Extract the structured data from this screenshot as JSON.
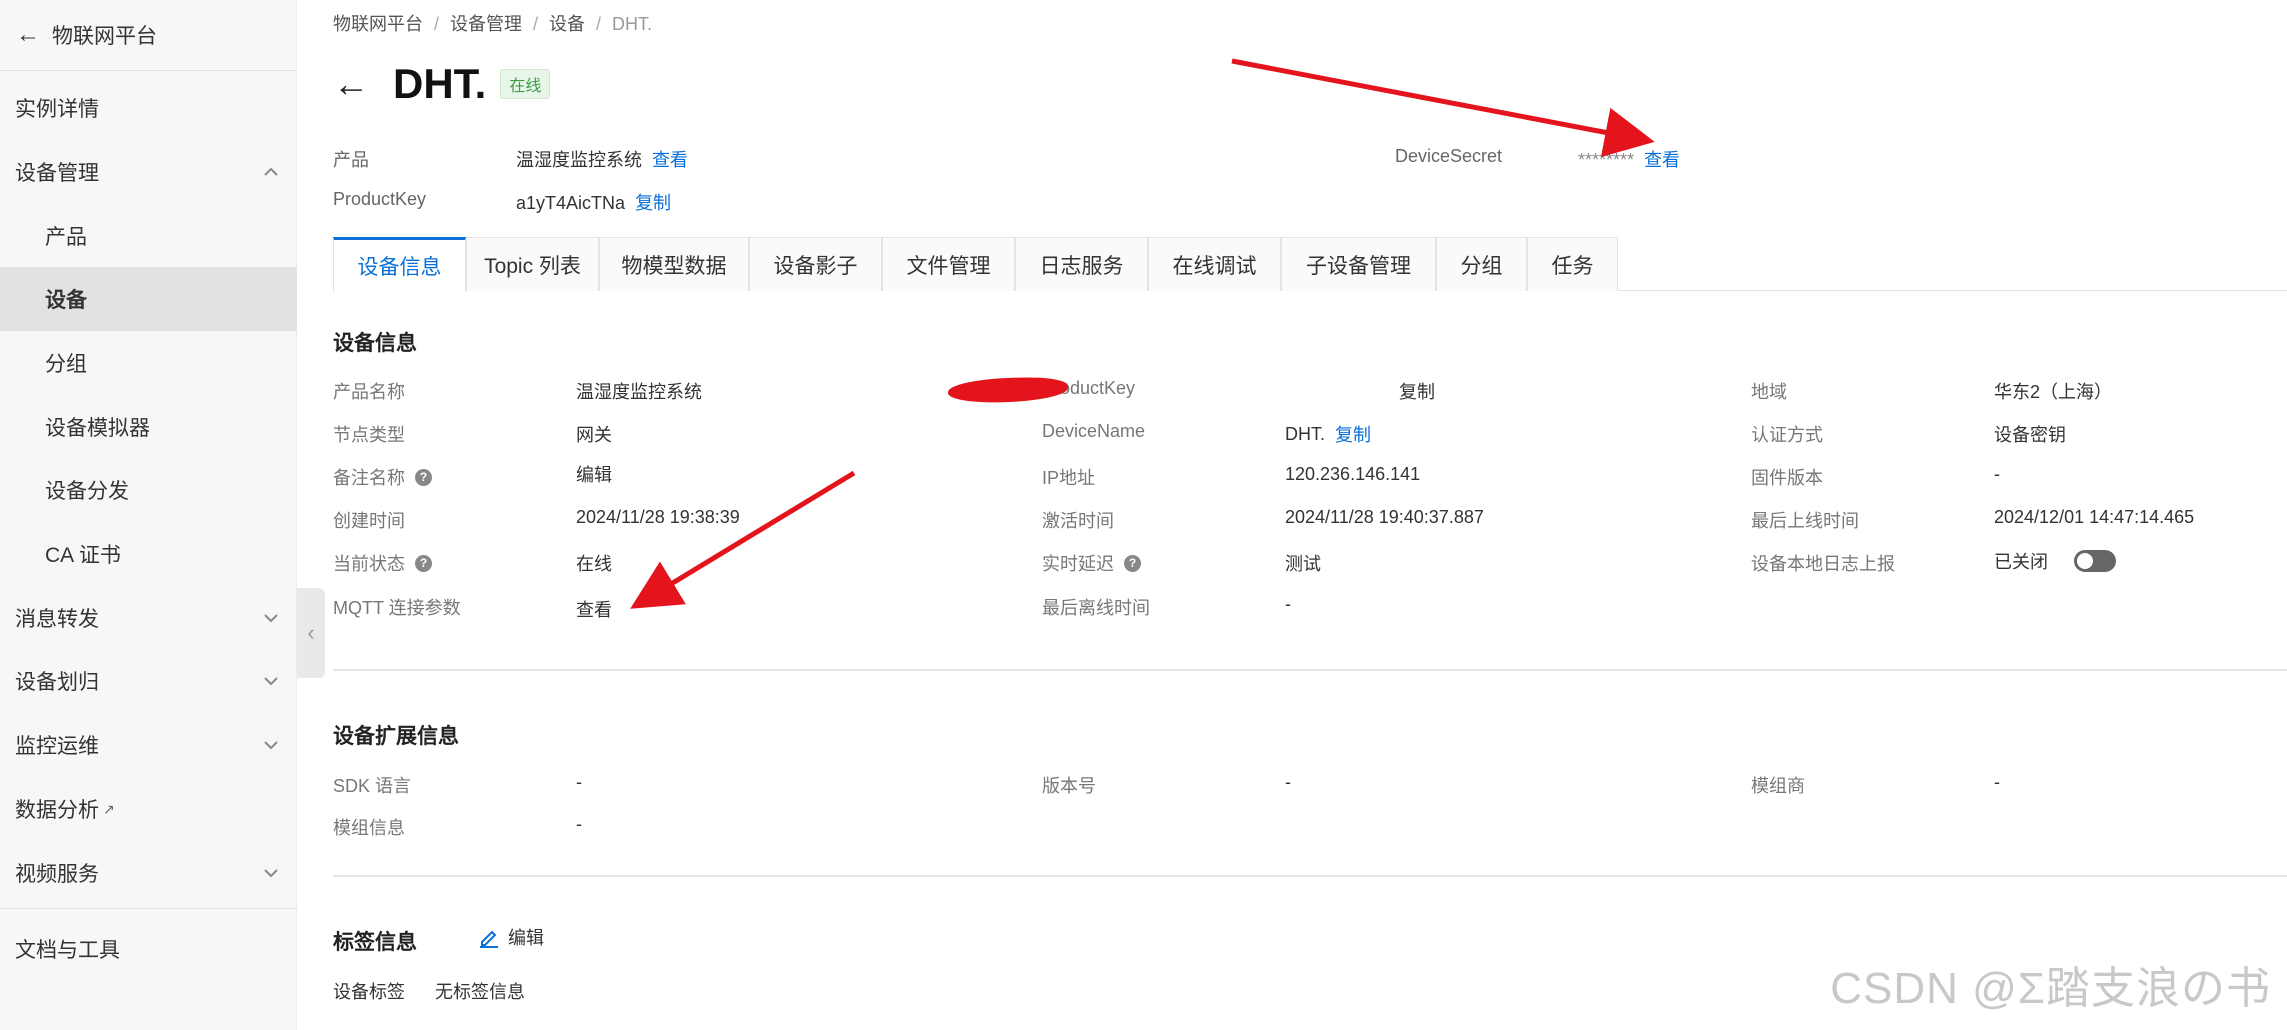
{
  "sidebar": {
    "back_title": "物联网平台",
    "items": [
      {
        "label": "实例详情"
      },
      {
        "label": "设备管理"
      },
      {
        "label": "产品"
      },
      {
        "label": "设备"
      },
      {
        "label": "分组"
      },
      {
        "label": "设备模拟器"
      },
      {
        "label": "设备分发"
      },
      {
        "label": "CA 证书"
      },
      {
        "label": "消息转发"
      },
      {
        "label": "设备划归"
      },
      {
        "label": "监控运维"
      },
      {
        "label": "数据分析"
      },
      {
        "label": "视频服务"
      },
      {
        "label": "文档与工具"
      }
    ]
  },
  "breadcrumb": [
    "物联网平台",
    "设备管理",
    "设备",
    "DHT."
  ],
  "header": {
    "title": "DHT.",
    "status_badge": "在线",
    "product_label": "产品",
    "product_value": "温湿度监控系统",
    "product_link": "查看",
    "productkey_label": "ProductKey",
    "productkey_value": "a1yT4AicTNa",
    "productkey_link": "复制",
    "devicesecret_label": "DeviceSecret",
    "devicesecret_value": "********",
    "devicesecret_link": "查看"
  },
  "tabs": [
    "设备信息",
    "Topic 列表",
    "物模型数据",
    "设备影子",
    "文件管理",
    "日志服务",
    "在线调试",
    "子设备管理",
    "分组",
    "任务"
  ],
  "device_info": {
    "title": "设备信息",
    "product_name_label": "产品名称",
    "product_name_value": "温湿度监控系统",
    "node_type_label": "节点类型",
    "node_type_value": "网关",
    "remark_label": "备注名称",
    "remark_link": "编辑",
    "created_label": "创建时间",
    "created_value": "2024/11/28 19:38:39",
    "state_label": "当前状态",
    "state_value": "在线",
    "mqtt_label": "MQTT 连接参数",
    "mqtt_link": "查看",
    "pk_label": "ProductKey",
    "pk_link": "复制",
    "devname_label": "DeviceName",
    "devname_value": "DHT.",
    "devname_link": "复制",
    "ip_label": "IP地址",
    "ip_value": "120.236.146.141",
    "activated_label": "激活时间",
    "activated_value": "2024/11/28 19:40:37.887",
    "latency_label": "实时延迟",
    "latency_link": "测试",
    "last_offline_label": "最后离线时间",
    "last_offline_value": "-",
    "region_label": "地域",
    "region_value": "华东2（上海）",
    "auth_label": "认证方式",
    "auth_value": "设备密钥",
    "firmware_label": "固件版本",
    "firmware_value": "-",
    "last_online_label": "最后上线时间",
    "last_online_value": "2024/12/01 14:47:14.465",
    "local_log_label": "设备本地日志上报",
    "local_log_value": "已关闭",
    "local_log_enabled": false
  },
  "ext_info": {
    "title": "设备扩展信息",
    "sdk_label": "SDK 语言",
    "sdk_value": "-",
    "version_label": "版本号",
    "version_value": "-",
    "vendor_label": "模组商",
    "vendor_value": "-",
    "module_label": "模组信息",
    "module_value": "-"
  },
  "tag_info": {
    "title": "标签信息",
    "edit_link": "编辑",
    "device_tag_label": "设备标签",
    "device_tag_value": "无标签信息"
  },
  "watermark": "CSDN @Σ踏支浪の书",
  "colors": {
    "link": "#0a6fd8",
    "arrow": "#e3141b",
    "online": "#3d9a46"
  }
}
